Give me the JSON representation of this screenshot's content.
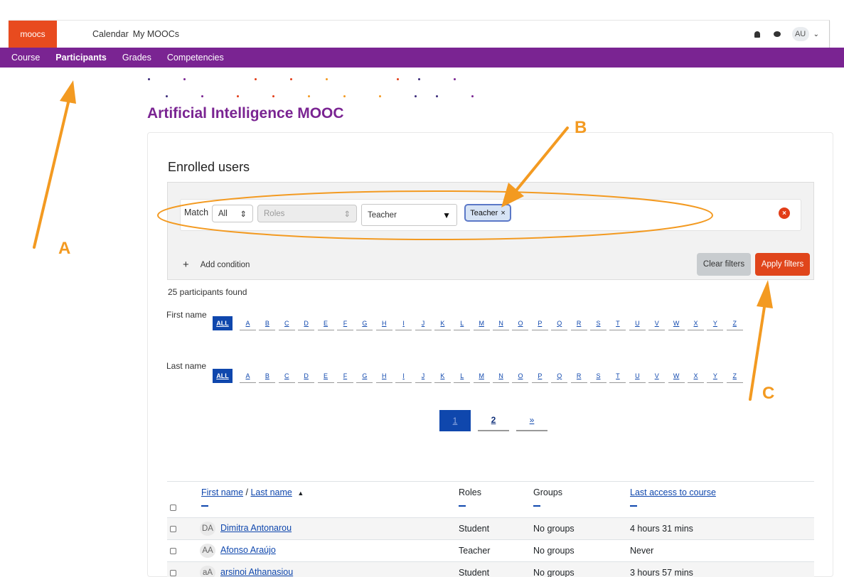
{
  "header": {
    "brand": "moocs",
    "nav": [
      "Calendar",
      "My MOOCs"
    ],
    "user_initials": "AU",
    "notifications_icon": "bell-icon",
    "messages_icon": "chat-bubble-icon"
  },
  "course_nav": {
    "items": [
      "Course",
      "Participants",
      "Grades",
      "Competencies"
    ],
    "active": "Participants"
  },
  "course_title": "Artificial Intelligence MOOC",
  "enrolled": {
    "title": "Enrolled users",
    "filter": {
      "match_label": "Match",
      "match_value": "All",
      "field_value": "Roles",
      "role_select": "Teacher",
      "chip_label": "Teacher",
      "chip_close": "×",
      "remove_icon": "×"
    },
    "add_condition": "Add condition",
    "add_icon": "+",
    "clear_button": "Clear filters",
    "apply_button": "Apply filters",
    "found_text": "25 participants found"
  },
  "name_filters": {
    "first_label": "First name",
    "last_label": "Last name",
    "letters": [
      "ALL",
      "A",
      "B",
      "C",
      "D",
      "E",
      "F",
      "G",
      "H",
      "I",
      "J",
      "K",
      "L",
      "M",
      "N",
      "O",
      "P",
      "Q",
      "R",
      "S",
      "T",
      "U",
      "V",
      "W",
      "X",
      "Y",
      "Z"
    ]
  },
  "pagination": {
    "pages": [
      "1",
      "2",
      "»"
    ],
    "current": "1"
  },
  "table": {
    "headers": {
      "first_name": "First name",
      "separator": " / ",
      "last_name": "Last name",
      "sort_icon": "▲",
      "roles": "Roles",
      "groups": "Groups",
      "last_access": "Last access to course"
    },
    "rows": [
      {
        "initials": "DA",
        "name": "Dimitra Antonarou",
        "role": "Student",
        "groups": "No groups",
        "last_access": "4 hours 31 mins"
      },
      {
        "initials": "AA",
        "name": "Afonso Araújo",
        "role": "Teacher",
        "groups": "No groups",
        "last_access": "Never"
      },
      {
        "initials": "aA",
        "name": "arsinoi Athanasiou",
        "role": "Student",
        "groups": "No groups",
        "last_access": "3 hours 57 mins"
      }
    ]
  },
  "annotations": {
    "a": "A",
    "b": "B",
    "c": "C",
    "color": "#f39a21"
  },
  "colors": {
    "brand": "#e84b1f",
    "nav_purple": "#7a2492",
    "link_blue": "#0f47ad",
    "apply": "#e0451b"
  }
}
